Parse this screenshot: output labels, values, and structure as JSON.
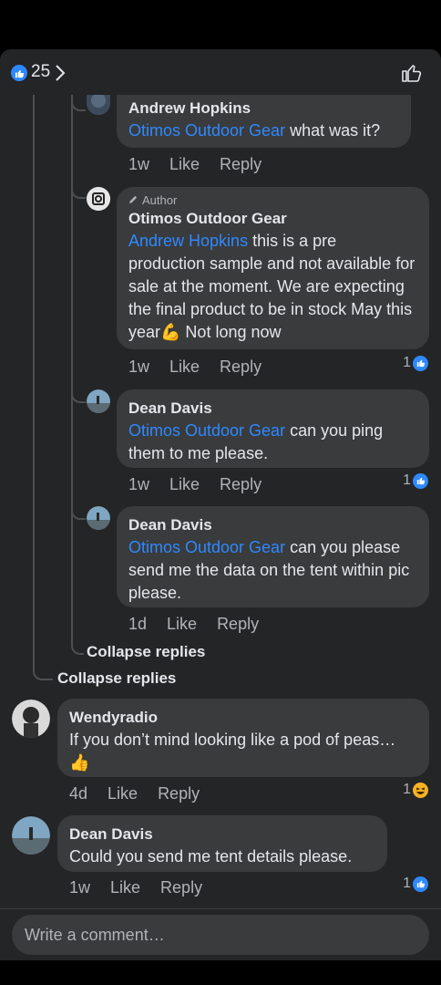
{
  "header": {
    "like_count": "25",
    "icons": [
      "like-reaction-icon",
      "chevron-right-icon",
      "thumbs-up-outline-icon"
    ]
  },
  "comments": [
    {
      "name": "Andrew Hopkins",
      "mention": "Otimos Outdoor Gear",
      "text": " what was it?",
      "time": "1w",
      "like": "Like",
      "reply": "Reply"
    },
    {
      "author_tag": "Author",
      "name": "Otimos Outdoor Gear",
      "mention": "Andrew Hopkins",
      "text": " this is a pre production sample and not available for sale at the moment. We are expecting the final product to be in stock May this year💪 Not long now",
      "time": "1w",
      "like": "Like",
      "reply": "Reply",
      "reactions": "1"
    },
    {
      "name": "Dean Davis",
      "mention": "Otimos Outdoor Gear",
      "text": " can you ping them to me please.",
      "time": "1w",
      "like": "Like",
      "reply": "Reply",
      "reactions": "1"
    },
    {
      "name": "Dean Davis",
      "mention": "Otimos Outdoor Gear",
      "text": " can you please send me the data on the tent within pic please.",
      "time": "1d",
      "like": "Like",
      "reply": "Reply"
    },
    {
      "name": "Wendyradio",
      "text": "If you don’t mind looking like a pod of peas… 👍",
      "time": "4d",
      "like": "Like",
      "reply": "Reply",
      "reactions": "1"
    },
    {
      "name": "Dean Davis",
      "text": "Could you send me tent details please.",
      "time": "1w",
      "like": "Like",
      "reply": "Reply",
      "reactions": "1"
    }
  ],
  "collapse_inner": "Collapse replies",
  "collapse_outer": "Collapse replies",
  "composer": {
    "placeholder": "Write a comment…"
  },
  "colors": {
    "accent": "#2e89ff",
    "bubble": "#3a3b3c",
    "background": "#242526"
  }
}
